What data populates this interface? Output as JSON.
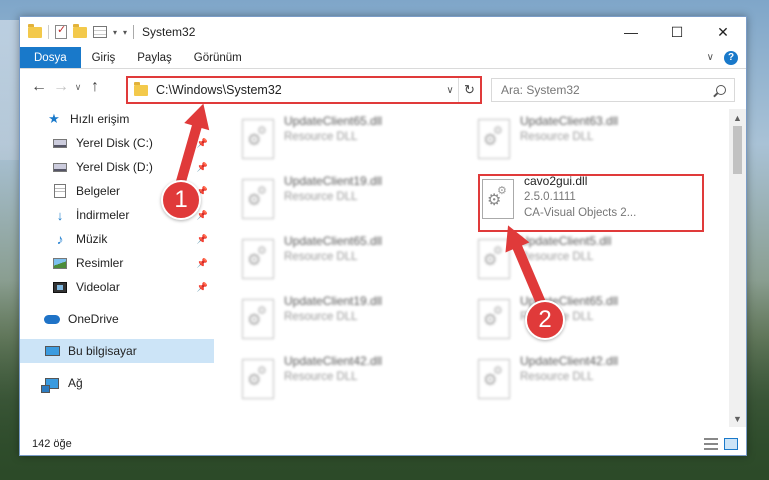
{
  "window": {
    "title": "System32",
    "controls": {
      "minimize": "—",
      "maximize": "☐",
      "close": "✕"
    }
  },
  "ribbon": {
    "tabs": [
      "Dosya",
      "Giriş",
      "Paylaş",
      "Görünüm"
    ],
    "help": "?"
  },
  "navigation": {
    "address": "C:\\Windows\\System32",
    "search_placeholder": "Ara: System32"
  },
  "sidebar": {
    "quick_access": "Hızlı erişim",
    "items": [
      {
        "label": "Yerel Disk (C:)",
        "icon": "disk-icon"
      },
      {
        "label": "Yerel Disk (D:)",
        "icon": "disk-icon"
      },
      {
        "label": "Belgeler",
        "icon": "documents-icon"
      },
      {
        "label": "İndirmeler",
        "icon": "download-icon"
      },
      {
        "label": "Müzik",
        "icon": "music-icon"
      },
      {
        "label": "Resimler",
        "icon": "pictures-icon"
      },
      {
        "label": "Videolar",
        "icon": "videos-icon"
      }
    ],
    "onedrive": "OneDrive",
    "this_pc": "Bu bilgisayar",
    "network": "Ağ"
  },
  "files": [
    {
      "name": "UpdateClient65.dll",
      "desc": "Resource DLL"
    },
    {
      "name": "UpdateClient63.dll",
      "desc": "Resource DLL"
    },
    {
      "name": "UpdateClient19.dll",
      "desc": "Resource DLL"
    },
    {
      "name": "UpdateClient65.dll",
      "desc": "Resource DLL"
    },
    {
      "name": "UpdateClient5.dll",
      "desc": "Resource DLL"
    },
    {
      "name": "UpdateClient19.dll",
      "desc": "Resource DLL"
    },
    {
      "name": "UpdateClient65.dll",
      "desc": "Resource DLL"
    },
    {
      "name": "UpdateClient42.dll",
      "desc": "Resource DLL"
    },
    {
      "name": "UpdateClient42.dll",
      "desc": "Resource DLL"
    }
  ],
  "highlighted_file": {
    "name": "cavo2gui.dll",
    "version": "2.5.0.1111",
    "company": "CA-Visual Objects 2..."
  },
  "status": {
    "item_count": "142 öğe"
  },
  "callouts": [
    "1",
    "2"
  ],
  "colors": {
    "accent": "#1979ca",
    "highlight": "#e03a3a",
    "selected": "#cce4f7"
  }
}
